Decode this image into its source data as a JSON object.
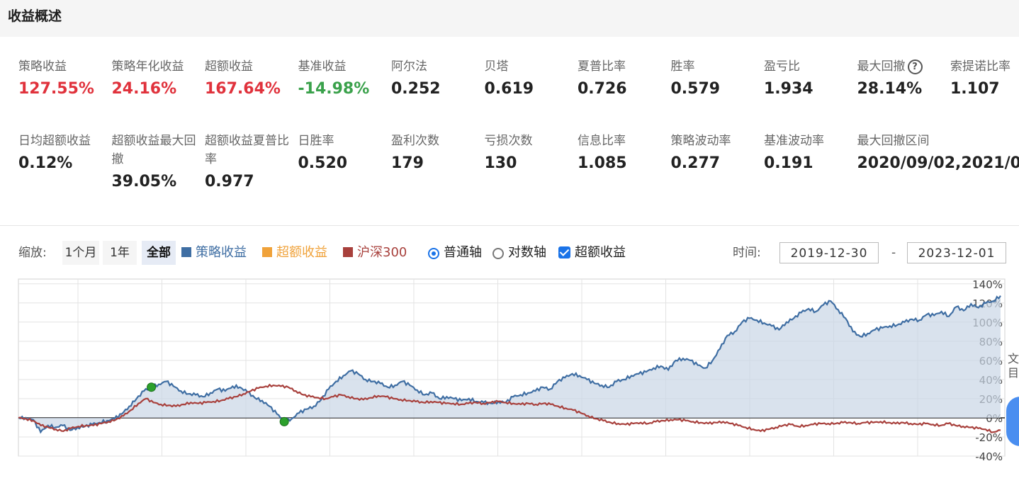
{
  "header": {
    "title": "收益概述"
  },
  "colors": {
    "red": "#e0323c",
    "green": "#3aa14b",
    "strategy": "#3f6ea3",
    "excess": "#f0a23a",
    "benchmark": "#a8403c",
    "accent": "#1a73e8"
  },
  "metrics_row1": [
    {
      "label": "策略收益",
      "value": "127.55%",
      "color": "red"
    },
    {
      "label": "策略年化收益",
      "value": "24.16%",
      "color": "red"
    },
    {
      "label": "超额收益",
      "value": "167.64%",
      "color": "red"
    },
    {
      "label": "基准收益",
      "value": "-14.98%",
      "color": "green"
    },
    {
      "label": "阿尔法",
      "value": "0.252"
    },
    {
      "label": "贝塔",
      "value": "0.619"
    },
    {
      "label": "夏普比率",
      "value": "0.726"
    },
    {
      "label": "胜率",
      "value": "0.579"
    },
    {
      "label": "盈亏比",
      "value": "1.934"
    },
    {
      "label": "最大回撤",
      "value": "28.14%",
      "icon": "help-circle-icon",
      "icon_glyph": "?"
    },
    {
      "label": "索提诺比率",
      "value": "1.107"
    }
  ],
  "metrics_row2": [
    {
      "label": "日均超额收益",
      "value": "0.12%"
    },
    {
      "label": "超额收益最大回撤",
      "value": "39.05%"
    },
    {
      "label": "超额收益夏普比率",
      "value": "0.977"
    },
    {
      "label": "日胜率",
      "value": "0.520"
    },
    {
      "label": "盈利次数",
      "value": "179"
    },
    {
      "label": "亏损次数",
      "value": "130"
    },
    {
      "label": "信息比率",
      "value": "1.085"
    },
    {
      "label": "策略波动率",
      "value": "0.277"
    },
    {
      "label": "基准波动率",
      "value": "0.191"
    },
    {
      "label": "最大回撤区间",
      "value": "2020/09/02,2021/0"
    }
  ],
  "toolbar": {
    "zoom_label": "缩放:",
    "zoom_1m": "1个月",
    "zoom_1y": "1年",
    "zoom_all": "全部",
    "legend_strategy": "策略收益",
    "legend_excess": "超额收益",
    "legend_benchmark": "沪深300",
    "axis_normal": "普通轴",
    "axis_log": "对数轴",
    "excess_check": "超额收益",
    "time_label": "时间:",
    "date_separator": "-",
    "date_from": "2019-12-30",
    "date_to": "2023-12-01"
  },
  "chart_data": {
    "type": "line",
    "x_start": "2019-12-30",
    "x_end": "2023-12-01",
    "ylim": [
      -40,
      145
    ],
    "y_ticks": [
      "140%",
      "120%",
      "100%",
      "80%",
      "60%",
      "40%",
      "20%",
      "0%",
      "-20%",
      "-40%"
    ],
    "y_tick_values": [
      140,
      120,
      100,
      80,
      60,
      40,
      20,
      0,
      -20,
      -40
    ],
    "grid": true,
    "series": [
      {
        "name": "策略收益",
        "color": "#3f6ea3",
        "area": true,
        "values": [
          0,
          0,
          -2,
          -15,
          -8,
          -10,
          -8,
          -13,
          -10,
          -9,
          -7,
          -5,
          -3,
          -1,
          4,
          12,
          20,
          28,
          32,
          35,
          38,
          33,
          28,
          25,
          24,
          22,
          26,
          30,
          28,
          33,
          32,
          27,
          21,
          18,
          12,
          4,
          -4,
          -1,
          5,
          9,
          12,
          19,
          30,
          38,
          44,
          49,
          46,
          40,
          38,
          36,
          32,
          34,
          38,
          34,
          29,
          24,
          26,
          20,
          22,
          20,
          18,
          20,
          17,
          16,
          15,
          17,
          16,
          22,
          24,
          26,
          28,
          32,
          30,
          38,
          42,
          46,
          44,
          40,
          36,
          34,
          32,
          38,
          40,
          44,
          46,
          48,
          52,
          54,
          50,
          60,
          62,
          60,
          55,
          52,
          60,
          72,
          86,
          90,
          100,
          104,
          102,
          99,
          96,
          92,
          100,
          104,
          110,
          114,
          111,
          118,
          122,
          113,
          104,
          90,
          85,
          88,
          92,
          94,
          96,
          97,
          100,
          103,
          102,
          108,
          107,
          111,
          106,
          116,
          112,
          119,
          115,
          120,
          122,
          127.55
        ]
      },
      {
        "name": "沪深300",
        "color": "#a8403c",
        "area": false,
        "values": [
          0,
          -1,
          -3,
          -8,
          -10,
          -12,
          -14,
          -11,
          -9,
          -8,
          -8,
          -6,
          -4,
          -2,
          2,
          8,
          15,
          20,
          16,
          14,
          13,
          12,
          14,
          16,
          15,
          16,
          17,
          18,
          20,
          22,
          25,
          28,
          31,
          33,
          34,
          33,
          32,
          28,
          24,
          22,
          21,
          20,
          22,
          24,
          22,
          20,
          19,
          21,
          23,
          22,
          20,
          19,
          18,
          17,
          16,
          17,
          16,
          15,
          15,
          14,
          15,
          16,
          15,
          16,
          17,
          16,
          15,
          14,
          15,
          14,
          15,
          14,
          12,
          10,
          8,
          5,
          2,
          -1,
          -3,
          -5,
          -6,
          -7,
          -6,
          -5,
          -6,
          -4,
          -3,
          -2,
          -2,
          -3,
          -4,
          -5,
          -6,
          -5,
          -4,
          -6,
          -8,
          -10,
          -12,
          -14,
          -12,
          -10,
          -8,
          -7,
          -9,
          -8,
          -7,
          -6,
          -6,
          -6,
          -5,
          -5,
          -6,
          -5,
          -5,
          -4,
          -5,
          -6,
          -5,
          -6,
          -7,
          -6,
          -7,
          -8,
          -6,
          -8,
          -9,
          -10,
          -11,
          -12,
          -14.98,
          -13
        ]
      }
    ],
    "markers": [
      {
        "label": "",
        "x_index": 18,
        "series": "策略收益",
        "color": "#2ca02c"
      },
      {
        "label": "",
        "x_index": 36,
        "series": "策略收益",
        "color": "#2ca02c"
      }
    ],
    "right_axis_text": "文\n目"
  }
}
